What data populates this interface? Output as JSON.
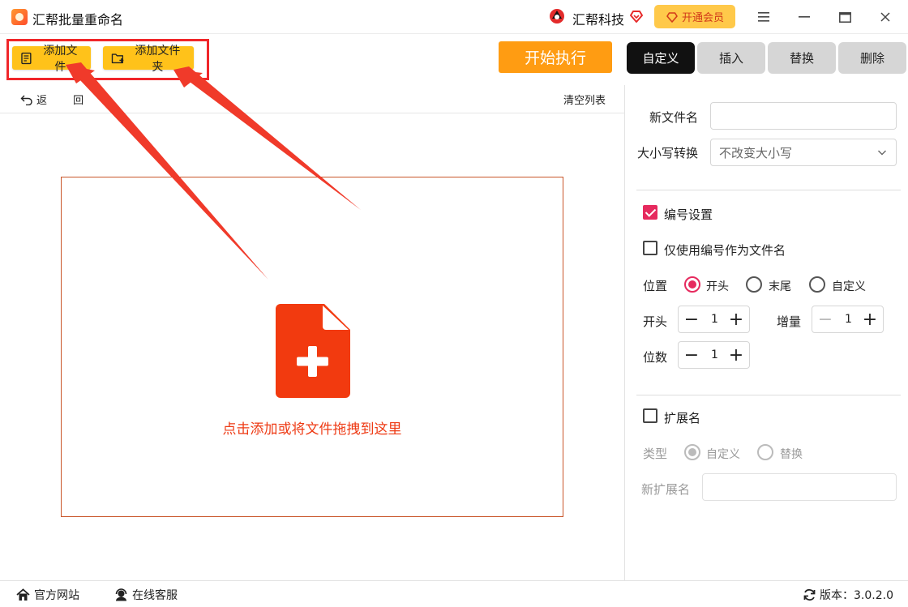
{
  "window": {
    "title": "汇帮批量重命名",
    "brand_name": "汇帮科技",
    "vip_label": "开通会员"
  },
  "toolbar": {
    "add_file_label": "添加文件",
    "add_folder_label": "添加文件夹",
    "start_label": "开始执行",
    "back_label": "返 回",
    "clear_label": "清空列表"
  },
  "tabs": [
    {
      "label": "自定义",
      "active": true
    },
    {
      "label": "插入",
      "active": false
    },
    {
      "label": "替换",
      "active": false
    },
    {
      "label": "删除",
      "active": false
    }
  ],
  "dropzone": {
    "hint": "点击添加或将文件拖拽到这里"
  },
  "panel": {
    "new_name_label": "新文件名",
    "new_name_value": "",
    "case_label": "大小写转换",
    "case_value": "不改变大小写",
    "numbering_label": "编号设置",
    "numbering_checked": true,
    "only_number_label": "仅使用编号作为文件名",
    "only_number_checked": false,
    "position_label": "位置",
    "position_options": [
      "开头",
      "末尾",
      "自定义"
    ],
    "position_selected": "开头",
    "start_label": "开头",
    "start_value": "1",
    "increment_label": "增量",
    "increment_value": "1",
    "digits_label": "位数",
    "digits_value": "1",
    "extension_label": "扩展名",
    "extension_checked": false,
    "type_label": "类型",
    "type_options": [
      "自定义",
      "替换"
    ],
    "type_selected": "自定义",
    "new_ext_label": "新扩展名",
    "new_ext_value": ""
  },
  "footer": {
    "website_label": "官方网站",
    "support_label": "在线客服",
    "version_label": "版本：3.0.2.0"
  },
  "colors": {
    "accent_yellow": "#ffc21a",
    "start_orange": "#ff9c12",
    "drop_red": "#ee3a14",
    "check_pink": "#e62a5e",
    "annotation_red": "#f0262a"
  }
}
